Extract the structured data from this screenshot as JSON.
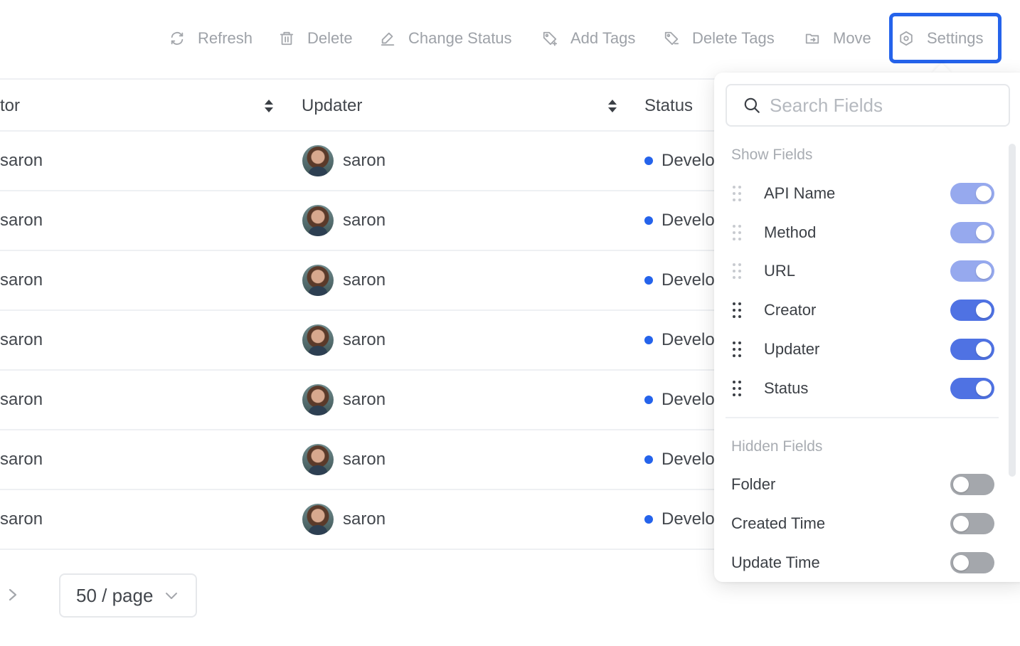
{
  "toolbar": {
    "refresh": "Refresh",
    "delete": "Delete",
    "change_status": "Change Status",
    "add_tags": "Add Tags",
    "delete_tags": "Delete Tags",
    "move": "Move",
    "settings": "Settings"
  },
  "table": {
    "headers": {
      "creator": "tor",
      "updater": "Updater",
      "status": "Status"
    },
    "rows": [
      {
        "creator": "saron",
        "updater": "saron",
        "status": "Develo"
      },
      {
        "creator": "saron",
        "updater": "saron",
        "status": "Develo"
      },
      {
        "creator": "saron",
        "updater": "saron",
        "status": "Develo"
      },
      {
        "creator": "saron",
        "updater": "saron",
        "status": "Develo"
      },
      {
        "creator": "saron",
        "updater": "saron",
        "status": "Develo"
      },
      {
        "creator": "saron",
        "updater": "saron",
        "status": "Develo"
      },
      {
        "creator": "saron",
        "updater": "saron",
        "status": "Develo"
      }
    ],
    "status_color": "#2563eb"
  },
  "pagination": {
    "page_size": "50 / page"
  },
  "settings_panel": {
    "search_placeholder": "Search Fields",
    "show_title": "Show Fields",
    "hidden_title": "Hidden Fields",
    "show_fields": [
      {
        "label": "API Name",
        "enabled": true,
        "locked": true
      },
      {
        "label": "Method",
        "enabled": true,
        "locked": true
      },
      {
        "label": "URL",
        "enabled": true,
        "locked": true
      },
      {
        "label": "Creator",
        "enabled": true,
        "locked": false
      },
      {
        "label": "Updater",
        "enabled": true,
        "locked": false
      },
      {
        "label": "Status",
        "enabled": true,
        "locked": false
      }
    ],
    "hidden_fields": [
      {
        "label": "Folder",
        "enabled": false
      },
      {
        "label": "Created Time",
        "enabled": false
      },
      {
        "label": "Update Time",
        "enabled": false
      }
    ],
    "colors": {
      "toggle_on": "#4f72e3",
      "toggle_on_locked": "#96a9ee",
      "toggle_off": "#a4a7ac",
      "highlight": "#2563eb"
    }
  }
}
